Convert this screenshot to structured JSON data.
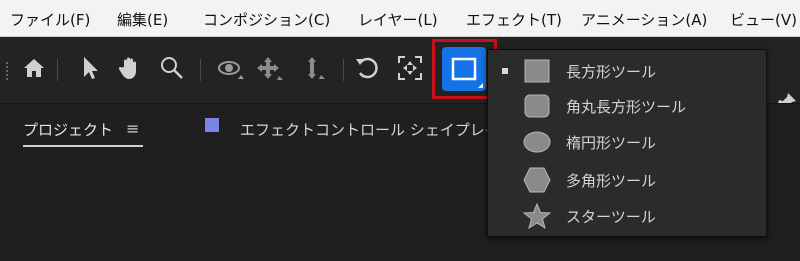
{
  "menubar": {
    "items": [
      "ファイル(F)",
      "編集(E)",
      "コンポジション(C)",
      "レイヤー(L)",
      "エフェクト(T)",
      "アニメーション(A)",
      "ビュー(V)"
    ]
  },
  "toolbar": {
    "tools": [
      "home-icon",
      "selection-arrow-icon",
      "hand-icon",
      "zoom-icon",
      "orbit-camera-icon",
      "pan-camera-icon",
      "dolly-camera-icon",
      "rotate-icon",
      "pan-behind-icon",
      "rectangle-tool-icon",
      "pin-icon"
    ],
    "accent_color": "#1473e6",
    "highlight_color": "#c8101a"
  },
  "flyout": {
    "items": [
      "長方形ツール",
      "角丸長方形ツール",
      "楕円形ツール",
      "多角形ツール",
      "スターツール"
    ],
    "selected_index": 0
  },
  "panels": {
    "project_tab": "プロジェクト",
    "menu_glyph": "≡",
    "effect_tab": "エフェクトコントロール シェイプレイ"
  }
}
